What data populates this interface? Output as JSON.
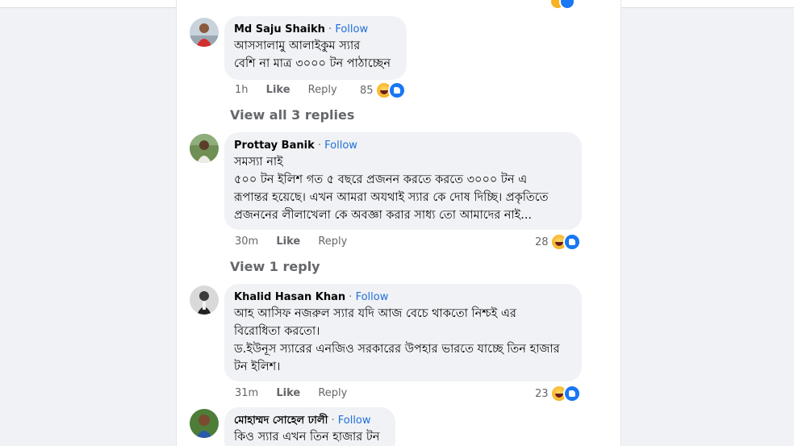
{
  "colors": {
    "follow": "#216fdb",
    "bubble": "#f0f2f5",
    "meta": "#65676b",
    "like": "#1877f2",
    "haha": "#f7b125"
  },
  "comments": [
    {
      "author": "Md Saju Shaikh",
      "follow": "Follow",
      "separator": "·",
      "text": "আসসালামু আলাইকুম স্যার\nবেশি না মাত্র ৩০০০ টন পাঠাচ্ছেন",
      "time": "1h",
      "like": "Like",
      "reply": "Reply",
      "reactions": "85",
      "reaction_icons": [
        "haha-icon",
        "like-icon"
      ],
      "view_replies": "View all 3 replies"
    },
    {
      "author": "Prottay Banik",
      "follow": "Follow",
      "separator": "·",
      "text": "সমস্যা নাই\n৫০০ টন ইলিশ গত ৫ বছরে প্রজনন করতে করতে ৩০০০ টন এ\nরূপান্তর হয়েছে। এখন আমরা অযথাই স্যার কে দোষ দিচ্ছি। প্রকৃতিতে\nপ্রজননের লীলাখেলা কে অবজ্ঞা করার সাধ্য তো আমাদের নাই...",
      "time": "30m",
      "like": "Like",
      "reply": "Reply",
      "reactions": "28",
      "reaction_icons": [
        "haha-icon",
        "like-icon"
      ],
      "view_replies": "View 1 reply"
    },
    {
      "author": "Khalid Hasan Khan",
      "follow": "Follow",
      "separator": "·",
      "text": "আহ আসিফ নজরুল স্যার যদি আজ বেচে থাকতো নিশ্চই এর\nবিরোধিতা করতো।\nড.ইউনূস স্যারের এনজিও সরকারের উপহার ভারতে যাচ্ছে তিন হাজার\nটন ইলিশ।",
      "time": "31m",
      "like": "Like",
      "reply": "Reply",
      "reactions": "23",
      "reaction_icons": [
        "haha-icon",
        "like-icon"
      ]
    },
    {
      "author": "মোহাম্মদ সোহেল ঢালী",
      "follow": "Follow",
      "separator": "·",
      "text": "কিও স্যার এখন তিন হাজার টন"
    }
  ]
}
